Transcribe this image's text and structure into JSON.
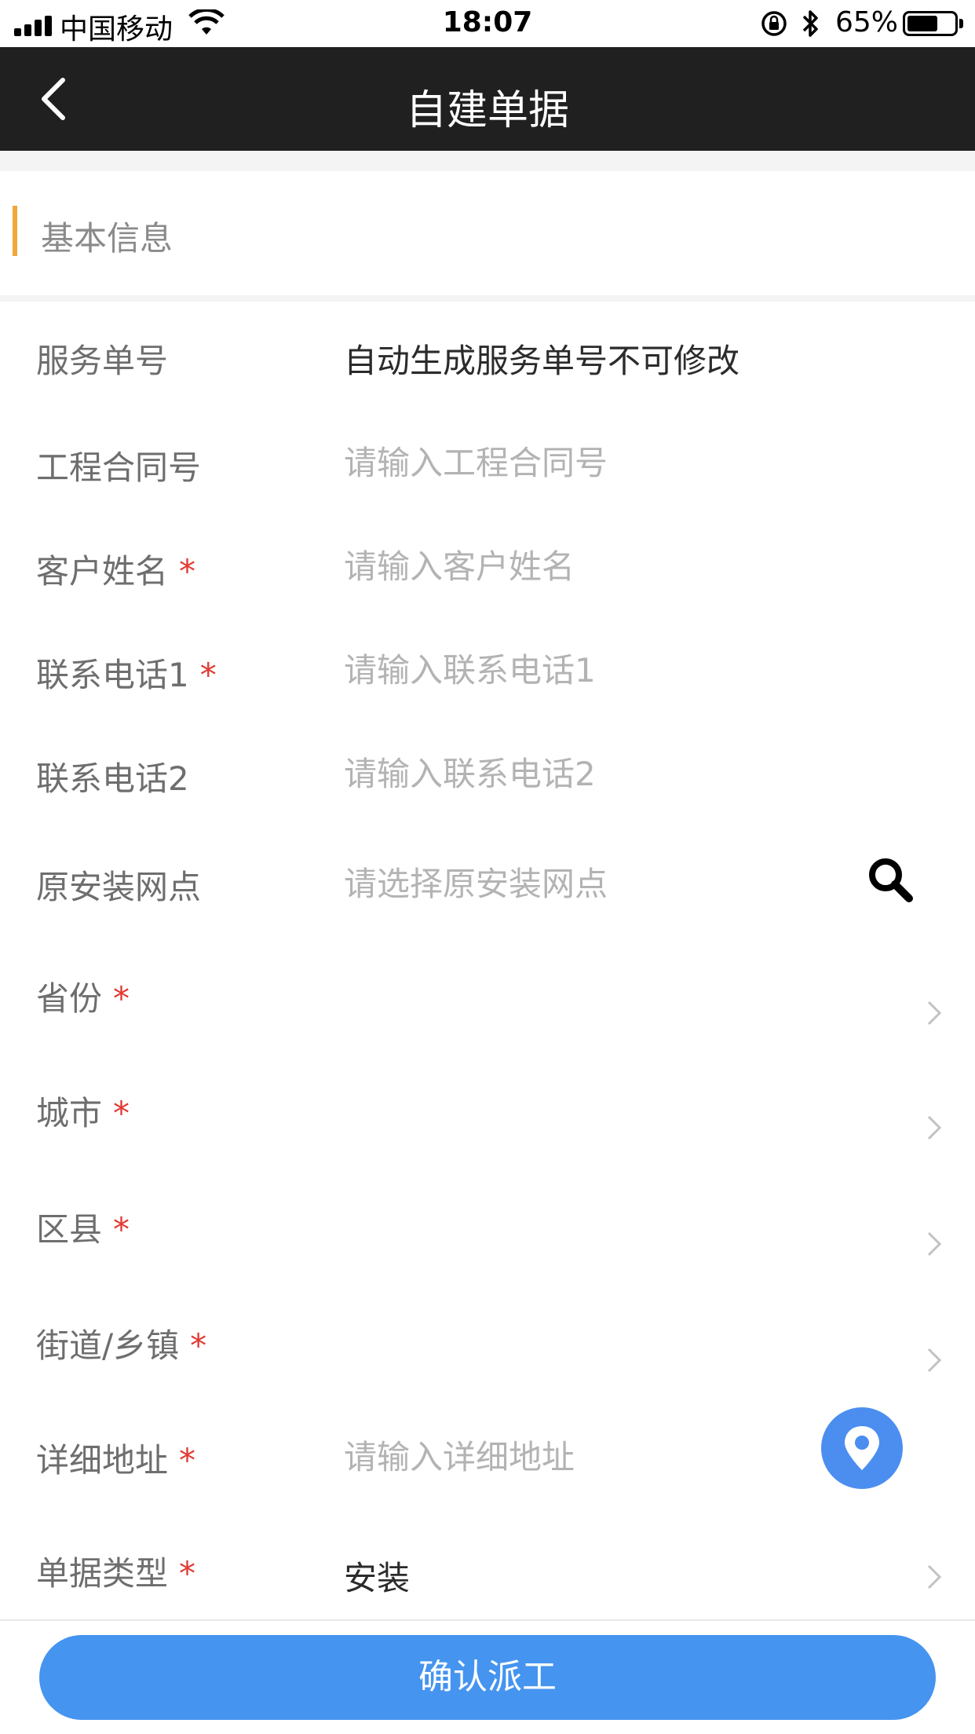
{
  "status_bar": {
    "carrier": "中国移动",
    "time": "18:07",
    "battery_percent": "65%",
    "battery_level": 0.65
  },
  "nav": {
    "title": "自建单据",
    "back_icon": "chevron-left-icon"
  },
  "section": {
    "title": "基本信息"
  },
  "fields": {
    "service_no": {
      "label": "服务单号",
      "value": "自动生成服务单号不可修改"
    },
    "contract_no": {
      "label": "工程合同号",
      "placeholder": "请输入工程合同号"
    },
    "customer_name": {
      "label": "客户姓名",
      "required": "*",
      "placeholder": "请输入客户姓名"
    },
    "phone1": {
      "label": "联系电话1",
      "required": "*",
      "placeholder": "请输入联系电话1"
    },
    "phone2": {
      "label": "联系电话2",
      "placeholder": "请输入联系电话2"
    },
    "original_outlet": {
      "label": "原安装网点",
      "placeholder": "请选择原安装网点",
      "icon": "search-icon"
    },
    "province": {
      "label": "省份",
      "required": "*"
    },
    "city": {
      "label": "城市",
      "required": "*"
    },
    "district": {
      "label": "区县",
      "required": "*"
    },
    "street": {
      "label": "街道/乡镇",
      "required": "*"
    },
    "address": {
      "label": "详细地址",
      "required": "*",
      "placeholder": "请输入详细地址",
      "icon": "location-pin-icon"
    },
    "order_type": {
      "label": "单据类型",
      "required": "*",
      "value": "安装"
    }
  },
  "actions": {
    "confirm": "确认派工"
  },
  "colors": {
    "nav_background": "#202020",
    "accent_bar": "#f0a73a",
    "required": "#e23a33",
    "primary_button": "#4594ef",
    "locate_button": "#4b8ef0"
  }
}
